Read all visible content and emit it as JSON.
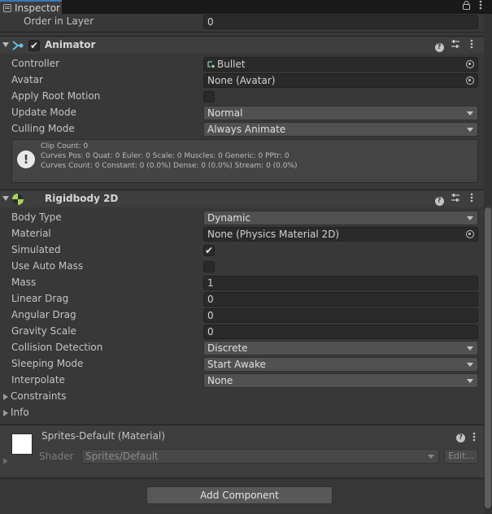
{
  "tab": {
    "title": "Inspector",
    "lock_icon": "lock-icon",
    "menu_icon": "kebab-menu-icon"
  },
  "order_in_layer": {
    "label": "Order in Layer",
    "value": "0"
  },
  "animator": {
    "title": "Animator",
    "fields": {
      "controller": {
        "label": "Controller",
        "value": "Bullet"
      },
      "avatar": {
        "label": "Avatar",
        "value": "None (Avatar)"
      },
      "apply_root_motion": {
        "label": "Apply Root Motion",
        "checked": false
      },
      "update_mode": {
        "label": "Update Mode",
        "value": "Normal"
      },
      "culling_mode": {
        "label": "Culling Mode",
        "value": "Always Animate"
      }
    },
    "info": {
      "line1": "Clip Count: 0",
      "line2": "Curves Pos: 0 Quat: 0 Euler: 0 Scale: 0 Muscles: 0 Generic: 0 PPtr: 0",
      "line3": "Curves Count: 0 Constant: 0 (0.0%) Dense: 0 (0.0%) Stream: 0 (0.0%)"
    }
  },
  "rigidbody": {
    "title": "Rigidbody 2D",
    "fields": {
      "body_type": {
        "label": "Body Type",
        "value": "Dynamic"
      },
      "material": {
        "label": "Material",
        "value": "None (Physics Material 2D)"
      },
      "simulated": {
        "label": "Simulated",
        "check": "✔"
      },
      "use_auto_mass": {
        "label": "Use Auto Mass"
      },
      "mass": {
        "label": "Mass",
        "value": "1"
      },
      "linear_drag": {
        "label": "Linear Drag",
        "value": "0"
      },
      "angular_drag": {
        "label": "Angular Drag",
        "value": "0"
      },
      "gravity_scale": {
        "label": "Gravity Scale",
        "value": "0"
      },
      "collision_detection": {
        "label": "Collision Detection",
        "value": "Discrete"
      },
      "sleeping_mode": {
        "label": "Sleeping Mode",
        "value": "Start Awake"
      },
      "interpolate": {
        "label": "Interpolate",
        "value": "None"
      }
    },
    "constraints": "Constraints",
    "info": "Info"
  },
  "material": {
    "name": "Sprites-Default (Material)",
    "shader_label": "Shader",
    "shader_value": "Sprites/Default",
    "edit_label": "Edit..."
  },
  "add_component": "Add Component",
  "header_icons": {
    "help": "?",
    "check": "✔"
  },
  "colors": {
    "tab_accent": "#3a79bb",
    "background": "#383838",
    "header": "#3e3e3e"
  }
}
